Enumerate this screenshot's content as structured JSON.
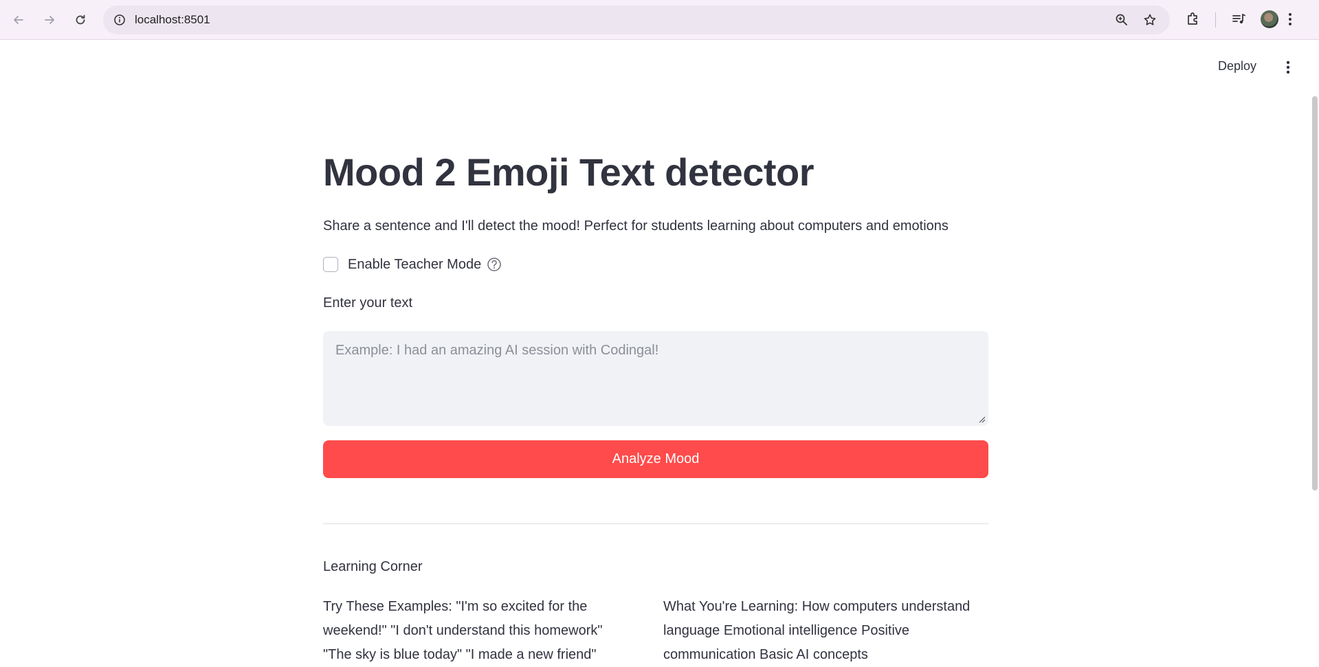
{
  "browser": {
    "url": "localhost:8501"
  },
  "app": {
    "deploy_label": "Deploy",
    "title": "Mood 2 Emoji Text detector",
    "subtitle": "Share a sentence and I'll detect the mood! Perfect for students learning about computers and emotions",
    "teacher_mode_label": "Enable Teacher Mode",
    "teacher_mode_checked": false,
    "input_label": "Enter your text",
    "input_placeholder": "Example: I had an amazing AI session with Codingal!",
    "input_value": "",
    "analyze_button": "Analyze Mood",
    "learning_heading": "Learning Corner",
    "examples_text": "Try These Examples: \"I'm so excited for the weekend!\" \"I don't understand this homework\" \"The sky is blue today\" \"I made a new friend\"",
    "learning_text": "What You're Learning: How computers understand language Emotional intelligence Positive communication Basic AI concepts"
  },
  "colors": {
    "primary": "#ff4b4b",
    "text": "#31333f",
    "input_bg": "#f0f2f6",
    "browser_bg": "#f7f0f8"
  },
  "icons": {
    "back": "back-arrow-icon",
    "forward": "forward-arrow-icon",
    "reload": "reload-icon",
    "site_info": "site-info-icon",
    "zoom": "zoom-icon",
    "bookmark": "star-icon",
    "extensions": "puzzle-icon",
    "media": "media-control-icon",
    "menu": "vertical-dots-icon",
    "help": "question-icon"
  }
}
